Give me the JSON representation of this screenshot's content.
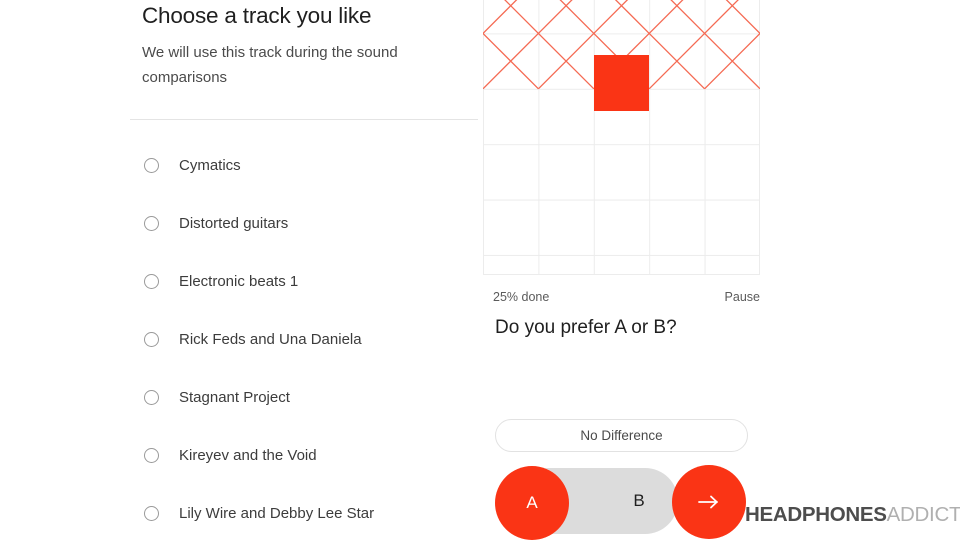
{
  "left": {
    "title": "Choose a track you like",
    "subtitle": "We will use this track during the sound comparisons",
    "tracks": [
      {
        "label": "Cymatics",
        "selected": false
      },
      {
        "label": "Distorted guitars",
        "selected": false
      },
      {
        "label": "Electronic beats 1",
        "selected": false
      },
      {
        "label": "Rick Feds and Una Daniela",
        "selected": false
      },
      {
        "label": "Stagnant Project",
        "selected": false
      },
      {
        "label": "Kireyev and the Void",
        "selected": false
      },
      {
        "label": "Lily Wire and Debby Lee Star",
        "selected": false
      }
    ]
  },
  "right": {
    "visualizer": {
      "columns": 5,
      "rows": 5,
      "pattern_rows": 2,
      "highlight_cell": {
        "row": 2,
        "column": 3
      },
      "highlight_color": "#fa3415",
      "pattern_color": "#f56a53",
      "grid_line_color": "#ececec"
    },
    "progress_label": "25% done",
    "progress_percent": 25,
    "pause_label": "Pause",
    "question": "Do you prefer A or B?",
    "no_difference_label": "No Difference",
    "toggle": {
      "option_a": "A",
      "option_b": "B",
      "selected": "A"
    },
    "next_icon": "arrow-right-icon",
    "accent_color": "#fa3415"
  },
  "watermark": {
    "bold": "HEADPHONES",
    "light": "ADDICT"
  }
}
